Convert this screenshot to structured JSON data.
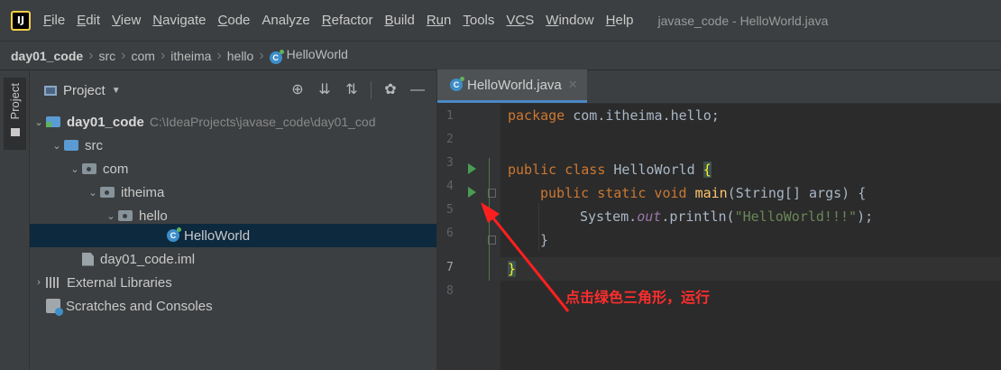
{
  "menubar": {
    "app_logo": "IJ",
    "items": [
      {
        "mnemonic": "F",
        "rest": "ile"
      },
      {
        "mnemonic": "E",
        "rest": "dit"
      },
      {
        "mnemonic": "V",
        "rest": "iew"
      },
      {
        "mnemonic": "N",
        "rest": "avigate"
      },
      {
        "mnemonic": "C",
        "rest": "ode"
      },
      {
        "mnemonic": "",
        "rest": "Analyze"
      },
      {
        "mnemonic": "R",
        "rest": "efactor"
      },
      {
        "mnemonic": "B",
        "rest": "uild"
      },
      {
        "mnemonic": "Ru",
        "rest": "n"
      },
      {
        "mnemonic": "T",
        "rest": "ools"
      },
      {
        "mnemonic": "VC",
        "rest": "S"
      },
      {
        "mnemonic": "W",
        "rest": "indow"
      },
      {
        "mnemonic": "H",
        "rest": "elp"
      }
    ],
    "window_title": "javase_code - HelloWorld.java"
  },
  "breadcrumb": [
    "day01_code",
    "src",
    "com",
    "itheima",
    "hello",
    "HelloWorld"
  ],
  "side_strip": {
    "tab_label": "Project"
  },
  "project_panel": {
    "title": "Project",
    "toolbar_icons": [
      "target-icon",
      "expand-all-icon",
      "collapse-all-icon",
      "gear-icon",
      "minimize-icon"
    ]
  },
  "tree": {
    "root_label": "day01_code",
    "root_path": "C:\\IdeaProjects\\javase_code\\day01_cod",
    "src": "src",
    "com": "com",
    "itheima": "itheima",
    "hello": "hello",
    "helloworld": "HelloWorld",
    "iml": "day01_code.iml",
    "external_libraries": "External Libraries",
    "scratches": "Scratches and Consoles"
  },
  "editor": {
    "tab_label": "HelloWorld.java",
    "line_numbers": [
      "1",
      "2",
      "3",
      "4",
      "5",
      "6",
      "7",
      "8"
    ],
    "current_line": "7",
    "code": {
      "l1_kw": "package ",
      "l1_rest": "com.itheima.hello;",
      "l3_kw": "public class ",
      "l3_name": "HelloWorld ",
      "l3_brace": "{",
      "l4_kw": "public static void ",
      "l4_fn": "main",
      "l4_rest": "(String[] args) {",
      "l5_a": "System.",
      "l5_field": "out",
      "l5_b": ".println(",
      "l5_str": "\"HelloWorld!!!\"",
      "l5_c": ");",
      "l6": "}",
      "l7_brace": "}"
    }
  },
  "annotation": {
    "text": "点击绿色三角形，运行",
    "color": "#ff2d2d"
  },
  "colors": {
    "run_arrow": "#499c54",
    "keyword": "#cc7832",
    "string": "#6a8759",
    "selection": "#0d293e"
  }
}
